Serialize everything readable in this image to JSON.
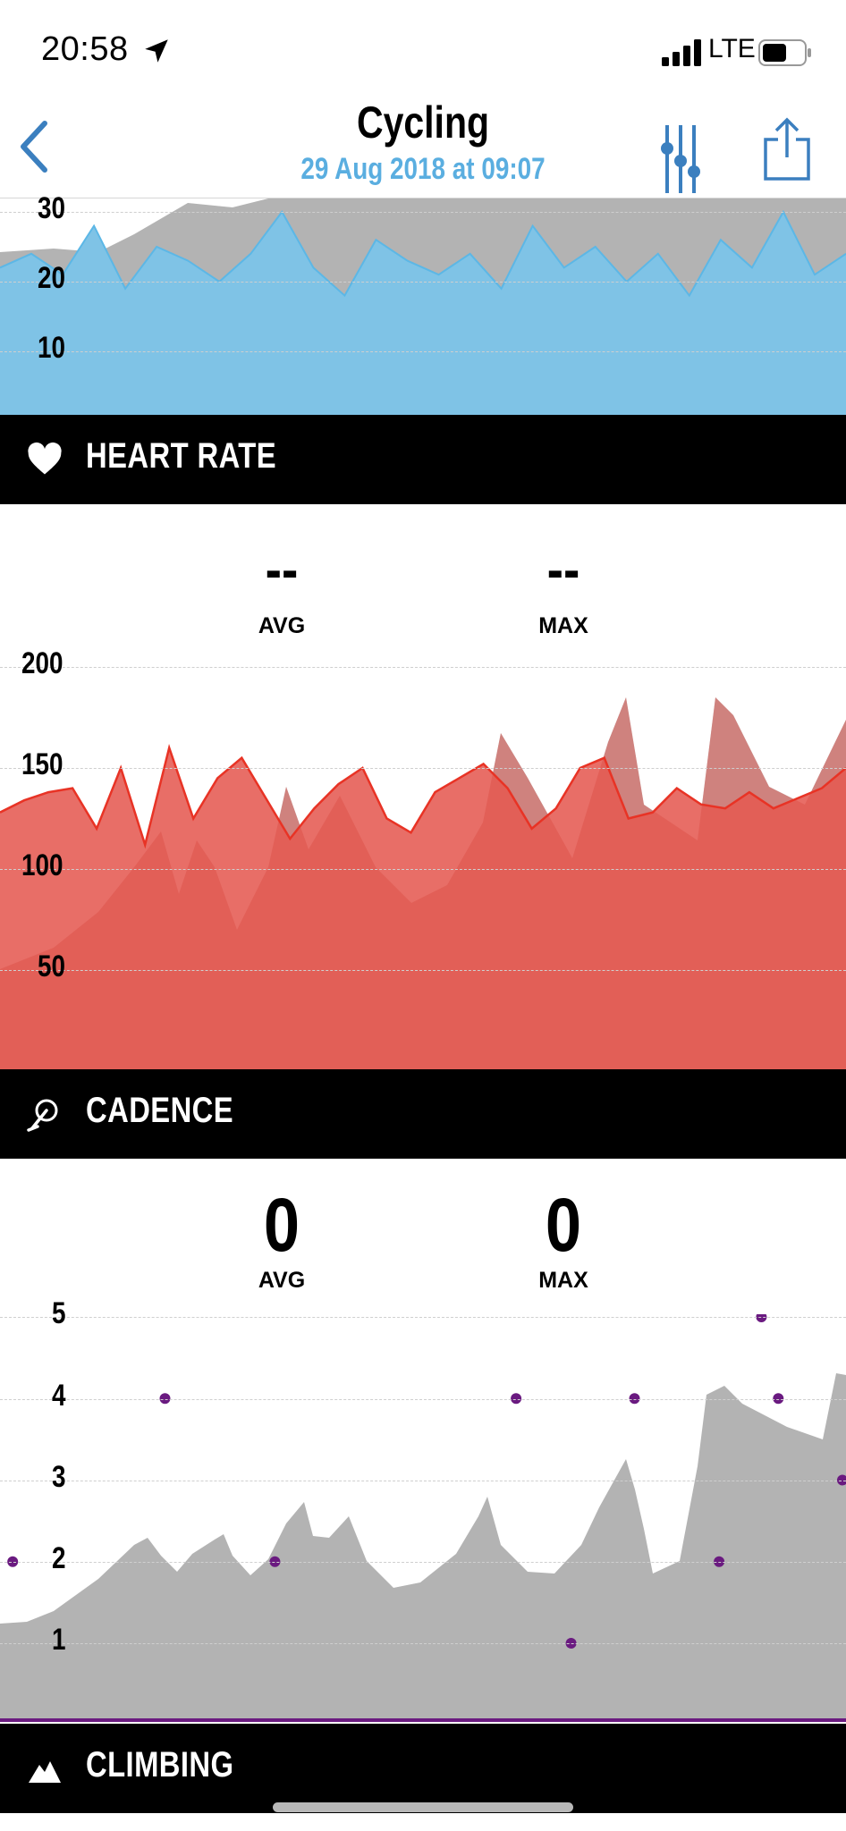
{
  "status": {
    "time": "20:58",
    "network": "LTE"
  },
  "header": {
    "title": "Cycling",
    "subtitle": "29 Aug 2018 at 09:07"
  },
  "speed_section": {
    "ticks": [
      "30",
      "20",
      "10"
    ]
  },
  "heart_rate": {
    "title": "HEART RATE",
    "avg_label": "AVG",
    "avg_value": "--",
    "max_label": "MAX",
    "max_value": "--",
    "ticks": [
      "200",
      "150",
      "100",
      "50"
    ]
  },
  "cadence": {
    "title": "CADENCE",
    "avg_label": "AVG",
    "avg_value": "0",
    "max_label": "MAX",
    "max_value": "0",
    "ticks": [
      "5",
      "4",
      "3",
      "2",
      "1"
    ]
  },
  "climbing": {
    "title": "CLIMBING"
  },
  "colors": {
    "speed_fill": "#7fc3e6",
    "speed_line": "#5cb7e6",
    "hr_fill": "#e55a52",
    "hr_line": "#e83325",
    "elevation": "#b3b3b3",
    "cadence_dot": "#6a1a80",
    "subtitle": "#5aaee0",
    "icon_blue": "#3b7fbf"
  },
  "chart_data": [
    {
      "type": "area",
      "series": [
        {
          "values": [
            22,
            24,
            21,
            28,
            19,
            25,
            23,
            20,
            24,
            30,
            22,
            18,
            26,
            23,
            21,
            24,
            19,
            28,
            22,
            25,
            20,
            24,
            18,
            26,
            22,
            30,
            21,
            24
          ]
        }
      ],
      "ylim": [
        0,
        35
      ],
      "ticks": [
        10,
        20,
        30
      ]
    },
    {
      "type": "area",
      "series": [
        {
          "values": [
            128,
            134,
            138,
            140,
            120,
            150,
            112,
            160,
            125,
            145,
            155,
            135,
            115,
            130,
            142,
            150,
            125,
            118,
            138,
            145,
            152,
            140,
            120,
            130,
            150,
            155,
            125,
            128,
            140,
            132,
            130,
            138,
            130,
            135,
            140,
            150
          ]
        }
      ],
      "ylim": [
        0,
        200
      ],
      "ticks": [
        50,
        100,
        150,
        200
      ]
    },
    {
      "type": "scatter",
      "series": [
        {
          "points": [
            [
              0.015,
              2
            ],
            [
              0.195,
              4
            ],
            [
              0.325,
              2
            ],
            [
              0.61,
              4
            ],
            [
              0.675,
              1
            ],
            [
              0.75,
              4
            ],
            [
              0.85,
              2
            ],
            [
              0.9,
              5
            ],
            [
              0.92,
              4
            ],
            [
              1.0,
              3
            ]
          ]
        }
      ],
      "ylim": [
        0,
        5
      ],
      "ticks": [
        1,
        2,
        3,
        4,
        5
      ]
    }
  ]
}
